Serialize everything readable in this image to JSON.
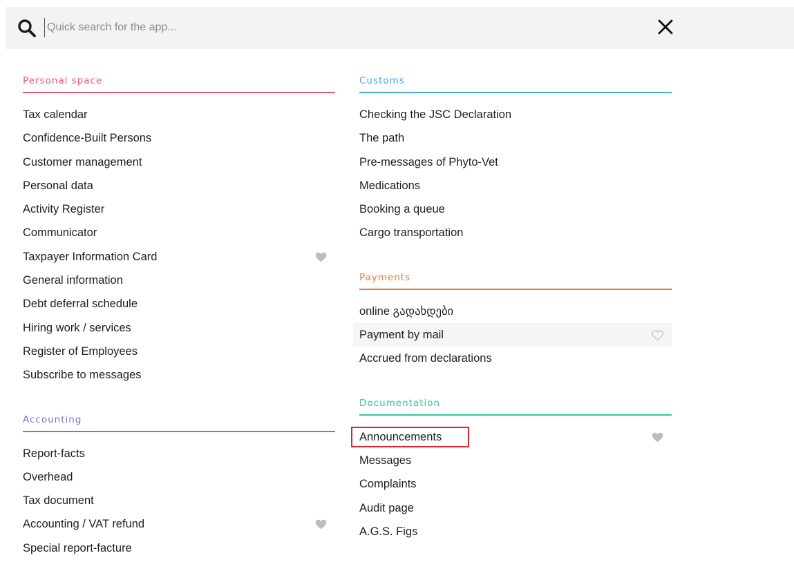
{
  "search": {
    "placeholder": "Quick search for the app...",
    "value": ""
  },
  "colors": {
    "personal": "#e8566e",
    "accounting": "#8a6bd0",
    "customs": "#3fa9dc",
    "payments": "#e0793e",
    "documentation": "#2ec7a0",
    "heart_filled": "#bdbdbd",
    "heart_outline": "#c4c4c4",
    "highlight_box": "#e0242b"
  },
  "sections": {
    "personal": {
      "title": "Personal space",
      "items": [
        {
          "label": "Tax calendar"
        },
        {
          "label": "Confidence-Built Persons"
        },
        {
          "label": "Customer management"
        },
        {
          "label": "Personal data"
        },
        {
          "label": "Activity Register"
        },
        {
          "label": "Communicator"
        },
        {
          "label": "Taxpayer Information Card",
          "favorite": "filled"
        },
        {
          "label": "General information"
        },
        {
          "label": "Debt deferral schedule"
        },
        {
          "label": "Hiring work / services"
        },
        {
          "label": "Register of Employees"
        },
        {
          "label": "Subscribe to messages"
        }
      ]
    },
    "accounting": {
      "title": "Accounting",
      "items": [
        {
          "label": "Report-facts"
        },
        {
          "label": "Overhead"
        },
        {
          "label": "Tax document"
        },
        {
          "label": "Accounting / VAT refund",
          "favorite": "filled"
        },
        {
          "label": "Special report-facture"
        }
      ]
    },
    "customs": {
      "title": "Customs",
      "items": [
        {
          "label": "Checking the JSC Declaration"
        },
        {
          "label": "The path"
        },
        {
          "label": "Pre-messages of Phyto-Vet"
        },
        {
          "label": "Medications"
        },
        {
          "label": "Booking a queue"
        },
        {
          "label": "Cargo transportation"
        }
      ]
    },
    "payments": {
      "title": "Payments",
      "items": [
        {
          "label": "online გადახდები"
        },
        {
          "label": "Payment by mail",
          "favorite": "outline",
          "hovered": true
        },
        {
          "label": "Accrued from declarations"
        }
      ]
    },
    "documentation": {
      "title": "Documentation",
      "items": [
        {
          "label": "Announcements",
          "favorite": "filled",
          "highlighted": true
        },
        {
          "label": "Messages"
        },
        {
          "label": "Complaints"
        },
        {
          "label": "Audit page"
        },
        {
          "label": "A.G.S. Figs"
        }
      ]
    }
  }
}
